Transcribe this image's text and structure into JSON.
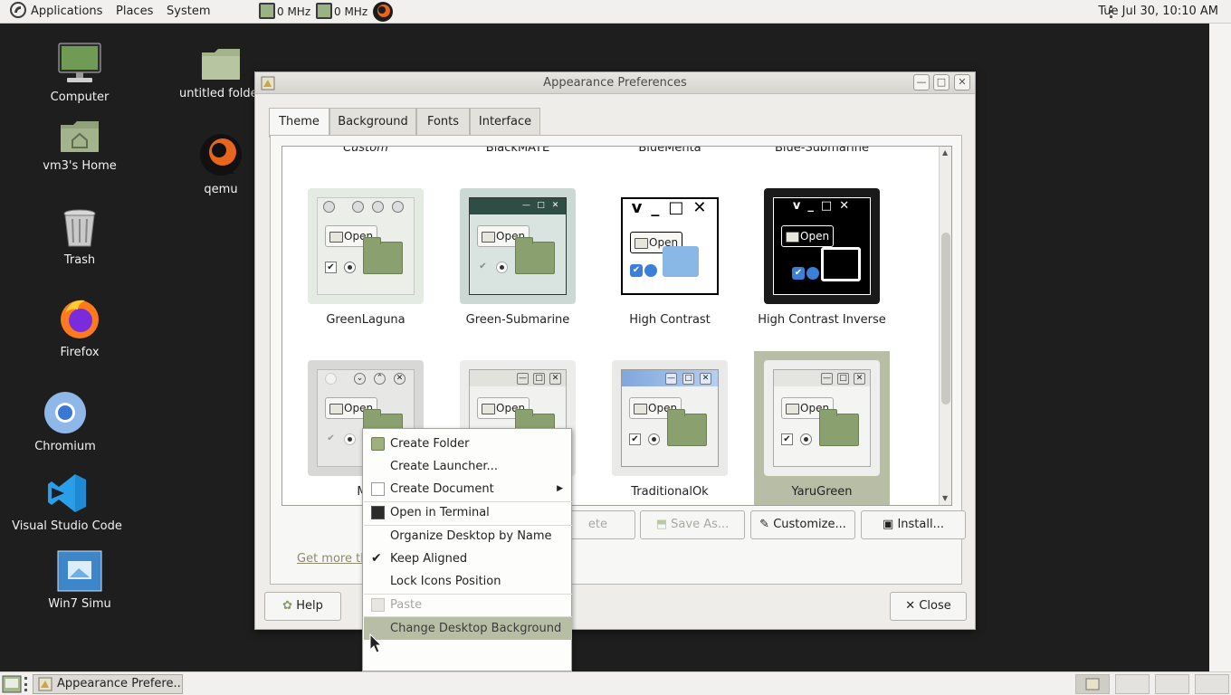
{
  "top_panel": {
    "menus": [
      "Applications",
      "Places",
      "System"
    ],
    "cpu1": "0 MHz",
    "cpu2": "0 MHz",
    "clock": "Tue Jul 30, 10:10 AM"
  },
  "desktop_icons": [
    {
      "label": "Computer",
      "icon": "computer-icon"
    },
    {
      "label": "untitled folder",
      "icon": "folder-icon"
    },
    {
      "label": "vm3's Home",
      "icon": "home-folder-icon"
    },
    {
      "label": "qemu",
      "icon": "qemu-icon"
    },
    {
      "label": "Trash",
      "icon": "trash-icon"
    },
    {
      "label": "Firefox",
      "icon": "firefox-icon"
    },
    {
      "label": "Chromium",
      "icon": "chromium-icon"
    },
    {
      "label": "Visual Studio Code",
      "icon": "vscode-icon"
    },
    {
      "label": "Win7 Simu",
      "icon": "win7-icon"
    }
  ],
  "window": {
    "title": "Appearance Preferences",
    "tabs": [
      "Theme",
      "Background",
      "Fonts",
      "Interface"
    ],
    "active_tab": "Theme",
    "partial_row": [
      "Custom",
      "BlackMATE",
      "BlueMenta",
      "Blue-Submarine"
    ],
    "themes_row1": [
      "GreenLaguna",
      "Green-Submarine",
      "High Contrast",
      "High Contrast Inverse"
    ],
    "themes_row2": [
      "Me",
      "",
      "TraditionalOk",
      "YaruGreen"
    ],
    "selected_theme": "YaruGreen",
    "preview_open_label": "Open",
    "buttons": {
      "delete": "ete",
      "save_as": "Save As...",
      "customize": "Customize...",
      "install": "Install..."
    },
    "get_more": "Get more th",
    "help": "Help",
    "close": "Close"
  },
  "context_menu": {
    "items": [
      {
        "label": "Create Folder",
        "icon": "folder-add-icon"
      },
      {
        "label": "Create Launcher...",
        "icon": ""
      },
      {
        "label": "Create Document",
        "icon": "document-icon",
        "submenu": true
      },
      {
        "label": "Open in Terminal",
        "icon": "terminal-icon"
      },
      {
        "label": "Organize Desktop by Name",
        "icon": ""
      },
      {
        "label": "Keep Aligned",
        "icon": "check-icon",
        "checked": true
      },
      {
        "label": "Lock Icons Position",
        "icon": ""
      },
      {
        "label": "Paste",
        "icon": "paste-icon",
        "disabled": true
      },
      {
        "label": "Change Desktop Background",
        "icon": "",
        "hover": true
      }
    ]
  },
  "bottom_panel": {
    "task": "Appearance Prefere..."
  },
  "colors": {
    "panel_bg": "#f1f0ee",
    "desktop_bg": "#1e1e1e",
    "selection": "#b8bda6",
    "folder_green": "#8aa06e"
  }
}
